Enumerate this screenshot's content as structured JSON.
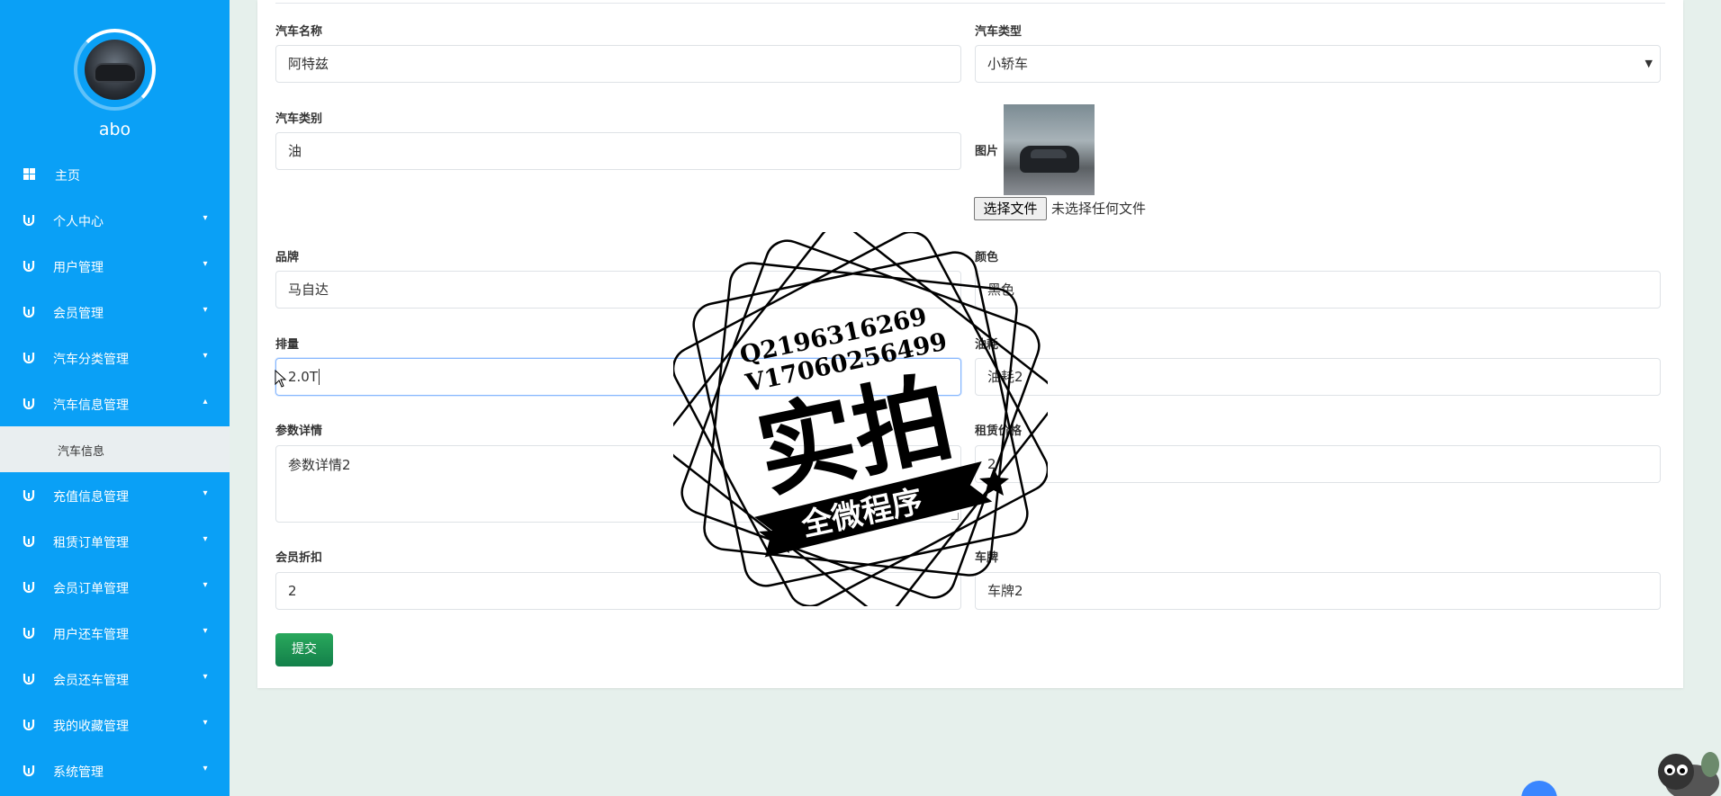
{
  "user": {
    "name": "abo"
  },
  "sidebar": {
    "items": [
      {
        "label": "主页",
        "icon": "dashboard-icon",
        "has_chevron": false
      },
      {
        "label": "个人中心",
        "icon": "settings-icon",
        "has_chevron": true,
        "chevron": "▾"
      },
      {
        "label": "用户管理",
        "icon": "settings-icon",
        "has_chevron": true,
        "chevron": "▾"
      },
      {
        "label": "会员管理",
        "icon": "settings-icon",
        "has_chevron": true,
        "chevron": "▾"
      },
      {
        "label": "汽车分类管理",
        "icon": "settings-icon",
        "has_chevron": true,
        "chevron": "▾"
      },
      {
        "label": "汽车信息管理",
        "icon": "settings-icon",
        "has_chevron": true,
        "chevron": "▴",
        "expanded": true
      },
      {
        "label": "充值信息管理",
        "icon": "settings-icon",
        "has_chevron": true,
        "chevron": "▾"
      },
      {
        "label": "租赁订单管理",
        "icon": "settings-icon",
        "has_chevron": true,
        "chevron": "▾"
      },
      {
        "label": "会员订单管理",
        "icon": "settings-icon",
        "has_chevron": true,
        "chevron": "▾"
      },
      {
        "label": "用户还车管理",
        "icon": "settings-icon",
        "has_chevron": true,
        "chevron": "▾"
      },
      {
        "label": "会员还车管理",
        "icon": "settings-icon",
        "has_chevron": true,
        "chevron": "▾"
      },
      {
        "label": "我的收藏管理",
        "icon": "settings-icon",
        "has_chevron": true,
        "chevron": "▾"
      },
      {
        "label": "系统管理",
        "icon": "settings-icon",
        "has_chevron": true,
        "chevron": "▾"
      }
    ],
    "submenu": {
      "label": "汽车信息"
    }
  },
  "form": {
    "car_name": {
      "label": "汽车名称",
      "value": "阿特兹"
    },
    "car_type": {
      "label": "汽车类型",
      "value": "小轿车"
    },
    "car_category": {
      "label": "汽车类别",
      "value": "油"
    },
    "image": {
      "label": "图片",
      "file_button": "选择文件",
      "file_status": "未选择任何文件"
    },
    "brand": {
      "label": "品牌",
      "value": "马自达"
    },
    "color": {
      "label": "颜色",
      "value": "黑色"
    },
    "displacement": {
      "label": "排量",
      "value": "2.0T"
    },
    "fuel": {
      "label": "油耗",
      "value": "油耗2"
    },
    "params": {
      "label": "参数详情",
      "value": "参数详情2"
    },
    "rent_price": {
      "label": "租赁价格",
      "value": "2"
    },
    "member_discount": {
      "label": "会员折扣",
      "value": "2"
    },
    "plate": {
      "label": "车牌",
      "value": "车牌2"
    },
    "submit_label": "提交"
  },
  "watermark": {
    "line1": "Q2196316269",
    "line2": "V17060256499",
    "main": "实拍",
    "banner": "全微程序"
  },
  "colors": {
    "sidebar": "#0aa0f6",
    "submit": "#198754",
    "background": "#e6f0ec"
  }
}
